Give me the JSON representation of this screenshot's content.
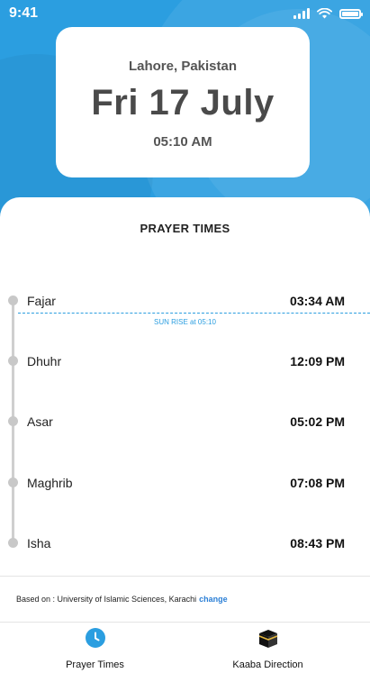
{
  "status_bar": {
    "time": "9:41"
  },
  "header": {
    "location": "Lahore, Pakistan",
    "date": "Fri 17 July",
    "current_time": "05:10 AM"
  },
  "prayer_section": {
    "title": "PRAYER TIMES",
    "prayers": [
      {
        "name": "Fajar",
        "time": "03:34 AM"
      },
      {
        "name": "Dhuhr",
        "time": "12:09 PM"
      },
      {
        "name": "Asar",
        "time": "05:02 PM"
      },
      {
        "name": "Maghrib",
        "time": "07:08 PM"
      },
      {
        "name": "Isha",
        "time": "08:43 PM"
      }
    ],
    "sunrise_label": "SUN RISE at 05:10"
  },
  "footer": {
    "based_on_text": "Based on : University of Islamic Sciences, Karachi",
    "change_link": "change"
  },
  "tab_bar": {
    "tabs": [
      {
        "label": "Prayer Times",
        "icon": "clock-icon",
        "active": true
      },
      {
        "label": "Kaaba Direction",
        "icon": "kaaba-icon",
        "active": false
      }
    ]
  },
  "colors": {
    "accent": "#2b9ee0",
    "link": "#2b7fd6",
    "timeline": "#cfcfcf"
  }
}
